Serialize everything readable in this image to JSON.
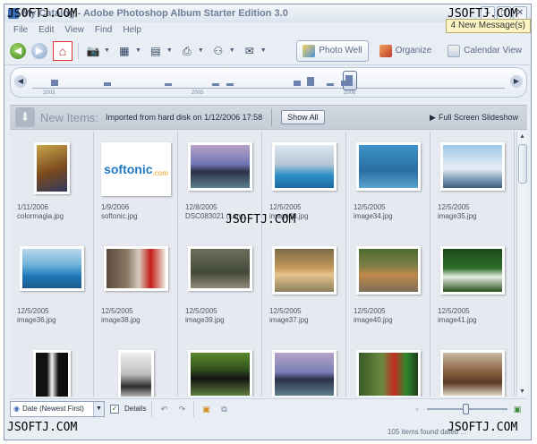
{
  "window": {
    "title": "My Catalog - Adobe Photoshop Album Starter Edition 3.0"
  },
  "menu": [
    "File",
    "Edit",
    "View",
    "Find",
    "Help"
  ],
  "messages": "4 New Message(s)",
  "views": [
    {
      "label": "Photo Well",
      "active": true,
      "icon": "photo-well-icon"
    },
    {
      "label": "Organize",
      "active": false,
      "icon": "organize-icon"
    },
    {
      "label": "Calendar View",
      "active": false,
      "icon": "calendar-icon"
    }
  ],
  "timeline": {
    "years": [
      "2003",
      "2005",
      "2006"
    ],
    "bars": [
      {
        "pos": 0.04,
        "h": 7
      },
      {
        "pos": 0.15,
        "h": 4
      },
      {
        "pos": 0.28,
        "h": 3
      },
      {
        "pos": 0.38,
        "h": 3
      },
      {
        "pos": 0.41,
        "h": 3
      },
      {
        "pos": 0.55,
        "h": 6
      },
      {
        "pos": 0.58,
        "h": 10
      },
      {
        "pos": 0.62,
        "h": 3
      },
      {
        "pos": 0.65,
        "h": 6
      },
      {
        "pos": 0.66,
        "h": 12
      }
    ],
    "handle": 0.67
  },
  "header": {
    "title": "New Items:",
    "subtitle": "Imported from hard disk on 1/12/2006 17:58",
    "show_all": "Show All",
    "slideshow": "Full Screen Slideshow"
  },
  "photos": [
    {
      "date": "1/11/2006",
      "name": "colormagia.jpg",
      "w": 40,
      "h": 58,
      "bg": "linear-gradient(160deg,#c9a54a,#7b4a1f 55%,#2f3a5e)"
    },
    {
      "date": "1/9/2006",
      "name": "softonic.jpg",
      "w": 78,
      "h": 60,
      "bg": "#ffffff",
      "logo": "softonic",
      "logo_sub": ".com"
    },
    {
      "date": "12/8/2005",
      "name": "DSC083021 (Larg...",
      "w": 72,
      "h": 54,
      "bg": "linear-gradient(#b8a2c9 0%,#6f74b3 45%,#2c3147 62%,#5b7e8e 100%)"
    },
    {
      "date": "12/5/2005",
      "name": "image33.jpg",
      "w": 72,
      "h": 54,
      "bg": "linear-gradient(#dfe7ef 0%,#b6c7d6 45%,#2c8fc6 70%,#1f6aa1 100%)"
    },
    {
      "date": "12/5/2005",
      "name": "image34.jpg",
      "w": 72,
      "h": 54,
      "bg": "linear-gradient(#3f93c8,#2a6ea3 60%,#5aa4cf)"
    },
    {
      "date": "12/5/2005",
      "name": "image35.jpg",
      "w": 72,
      "h": 54,
      "bg": "linear-gradient(#9ec7ea 0%,#e7eef5 55%,#7d9bb8 80%,#3f5f7d 100%)"
    },
    {
      "date": "12/5/2005",
      "name": "image36.jpg",
      "w": 72,
      "h": 50,
      "bg": "linear-gradient(#bcd7ee 0%,#6fb3d8 40%,#1d78b6 70%,#1a5a8c 100%)"
    },
    {
      "date": "12/5/2005",
      "name": "image38.jpg",
      "w": 72,
      "h": 50,
      "bg": "linear-gradient(90deg,#5a4a3c 0%,#8b7a66 35%,#d6cbbf 55%,#c41c17 75%,#f2ede7 100%)"
    },
    {
      "date": "12/5/2005",
      "name": "image39.jpg",
      "w": 72,
      "h": 50,
      "bg": "linear-gradient(#6d6f5c,#444a3a 60%,#8f8a78)"
    },
    {
      "date": "12/5/2005",
      "name": "image37.jpg",
      "w": 72,
      "h": 54,
      "bg": "linear-gradient(#7b6a48 0%,#c79a5c 45%,#e8c48d 60%,#8b7f5a 100%)"
    },
    {
      "date": "12/5/2005",
      "name": "image40.jpg",
      "w": 72,
      "h": 54,
      "bg": "linear-gradient(#4e6b2f 0%,#7f7e48 40%,#c18a4a 60%,#7c6e58 100%)"
    },
    {
      "date": "12/5/2005",
      "name": "image41.jpg",
      "w": 72,
      "h": 54,
      "bg": "linear-gradient(#1d4a1b 0%,#2f6d2a 45%,#e6efe2 65%,#27521f 100%)"
    },
    {
      "date": "",
      "name": "",
      "w": 42,
      "h": 60,
      "bg": "linear-gradient(90deg,#111 0%,#111 35%,#f3f3f3 50%,#111 70%,#0d0d0d 100%)"
    },
    {
      "date": "",
      "name": "",
      "w": 40,
      "h": 60,
      "bg": "linear-gradient(#f0f0f0,#bdbdbd 45%,#2e2e2e 70%,#efefef)"
    },
    {
      "date": "",
      "name": "",
      "w": 72,
      "h": 54,
      "bg": "linear-gradient(#5a8a2c 0%,#2f4f1d 40%,#141414 60%,#5f7e3c 100%)"
    },
    {
      "date": "",
      "name": "",
      "w": 72,
      "h": 54,
      "bg": "linear-gradient(#b7a3c7 0%,#7a7fb6 45%,#2d3149 62%,#5f7f8c 100%)"
    },
    {
      "date": "",
      "name": "",
      "w": 72,
      "h": 54,
      "bg": "linear-gradient(90deg,#3c5a2a 0%,#6a8a3c 40%,#c22c20 60%,#2e8a2c 80%,#1e3a1a 100%)"
    },
    {
      "date": "",
      "name": "",
      "w": 72,
      "h": 54,
      "bg": "linear-gradient(#c9b9a6 0%,#8a5f3e 45%,#5a3a25 70%,#e2d5c5 100%)"
    }
  ],
  "bottom": {
    "sort": "Date (Newest First)",
    "details": "Details"
  },
  "status": "105 items found dated ...",
  "watermark": "JSOFTJ.COM"
}
